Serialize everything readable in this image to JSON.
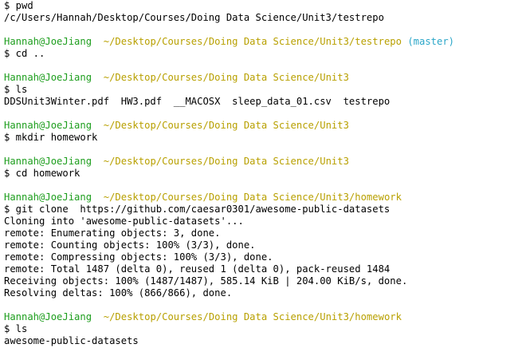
{
  "terminal": {
    "l1": "$ pwd",
    "l2": "/c/Users/Hannah/Desktop/Courses/Doing Data Science/Unit3/testrepo",
    "p1_user": "Hannah@JoeJiang",
    "p1_path": "~/Desktop/Courses/Doing Data Science/Unit3/testrepo",
    "p1_branch": "(master)",
    "l3": "$ cd ..",
    "p2_user": "Hannah@JoeJiang",
    "p2_path": "~/Desktop/Courses/Doing Data Science/Unit3",
    "l4": "$ ls",
    "l5": "DDSUnit3Winter.pdf  HW3.pdf  __MACOSX  sleep_data_01.csv  testrepo",
    "p3_user": "Hannah@JoeJiang",
    "p3_path": "~/Desktop/Courses/Doing Data Science/Unit3",
    "l6": "$ mkdir homework",
    "p4_user": "Hannah@JoeJiang",
    "p4_path": "~/Desktop/Courses/Doing Data Science/Unit3",
    "l7": "$ cd homework",
    "p5_user": "Hannah@JoeJiang",
    "p5_path": "~/Desktop/Courses/Doing Data Science/Unit3/homework",
    "l8": "$ git clone  https://github.com/caesar0301/awesome-public-datasets",
    "l9": "Cloning into 'awesome-public-datasets'...",
    "l10": "remote: Enumerating objects: 3, done.",
    "l11": "remote: Counting objects: 100% (3/3), done.",
    "l12": "remote: Compressing objects: 100% (3/3), done.",
    "l13": "remote: Total 1487 (delta 0), reused 1 (delta 0), pack-reused 1484",
    "l14": "Receiving objects: 100% (1487/1487), 585.14 KiB | 204.00 KiB/s, done.",
    "l15": "Resolving deltas: 100% (866/866), done.",
    "p6_user": "Hannah@JoeJiang",
    "p6_path": "~/Desktop/Courses/Doing Data Science/Unit3/homework",
    "l16": "$ ls",
    "l17": "awesome-public-datasets"
  },
  "colors": {
    "user": "#1e9e1e",
    "path": "#b8a000",
    "branch": "#2aa6c8",
    "text": "#000000",
    "background": "#ffffff"
  }
}
